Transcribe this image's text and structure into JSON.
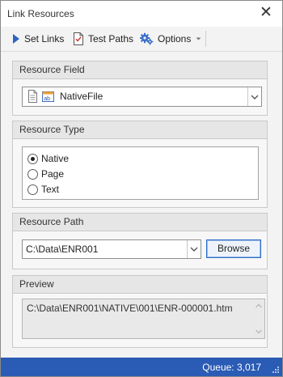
{
  "window": {
    "title": "Link Resources"
  },
  "toolbar": {
    "set_links": "Set Links",
    "test_paths": "Test Paths",
    "options": "Options"
  },
  "resource_field": {
    "header": "Resource Field",
    "value": "NativeFile"
  },
  "resource_type": {
    "header": "Resource Type",
    "options": [
      "Native",
      "Page",
      "Text"
    ],
    "selected": "Native"
  },
  "resource_path": {
    "header": "Resource Path",
    "value": "C:\\Data\\ENR001",
    "browse_label": "Browse"
  },
  "preview": {
    "header": "Preview",
    "text": "C:\\Data\\ENR001\\NATIVE\\001\\ENR-000001.htm"
  },
  "status": {
    "queue": "Queue: 3,017"
  },
  "colors": {
    "accent": "#2a5bb5",
    "browse_border": "#2b6cc8"
  },
  "icons": [
    "close-icon",
    "play-arrow-icon",
    "document-check-icon",
    "gears-icon",
    "dropdown-arrow-icon",
    "file-field-icon",
    "chevron-down-icon",
    "radio-icon",
    "scroll-up-icon",
    "scroll-down-icon",
    "resize-grip-icon"
  ]
}
